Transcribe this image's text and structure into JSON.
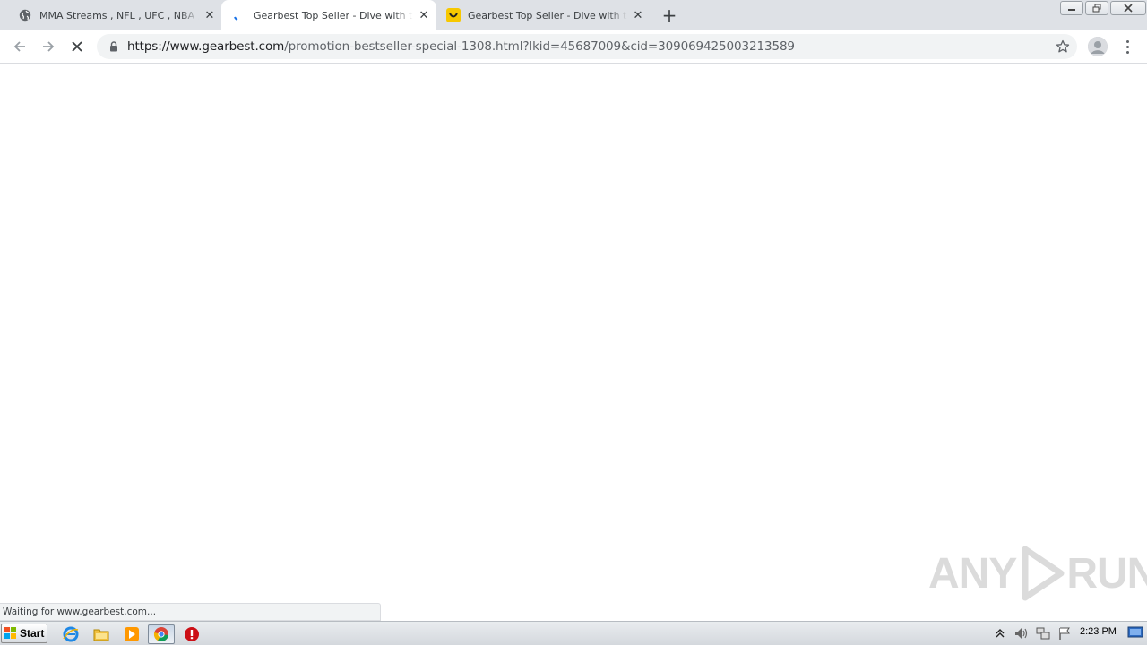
{
  "browser": {
    "tabs": [
      {
        "title": "MMA Streams , NFL , UFC , NBA , Bo",
        "favicon": "globe-icon",
        "active": false
      },
      {
        "title": "Gearbest Top Seller - Dive with the C",
        "favicon": "loading-spinner-icon",
        "active": true
      },
      {
        "title": "Gearbest Top Seller - Dive with the C",
        "favicon": "gearbest-smile-icon",
        "active": false
      }
    ],
    "new_tab_label": "+",
    "url_host": "https://www.gearbest.com",
    "url_path": "/promotion-bestseller-special-1308.html?lkid=45687009&cid=309069425003213589"
  },
  "status_bar": {
    "text": "Waiting for www.gearbest.com..."
  },
  "watermark": {
    "left": "ANY",
    "right": "RUN"
  },
  "taskbar": {
    "start_label": "Start",
    "clock": "2:23 PM"
  },
  "colors": {
    "accent": "#1a73e8",
    "gearbest_yellow": "#f7c800",
    "opera_red": "#cc0f16"
  }
}
